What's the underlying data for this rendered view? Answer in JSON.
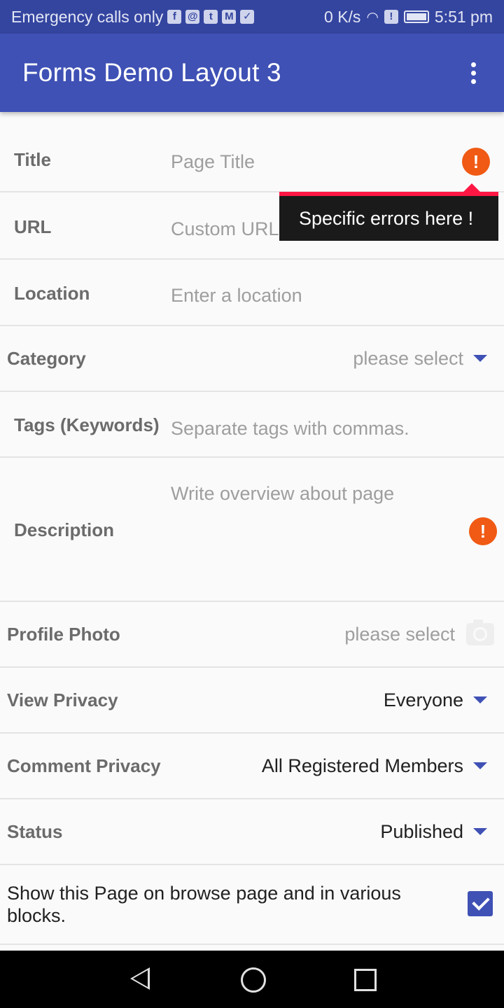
{
  "status_bar": {
    "carrier": "Emergency calls only",
    "speed": "0 K/s",
    "time": "5:51 pm",
    "icons": [
      "facebook-icon",
      "app-icon",
      "twitter-icon",
      "mail-icon",
      "check-icon",
      "wifi-icon",
      "alert-icon",
      "battery-icon"
    ]
  },
  "app_bar": {
    "title": "Forms Demo Layout 3",
    "menu_icon": "more-vert-icon"
  },
  "form": {
    "title": {
      "label": "Title",
      "placeholder": "Page Title",
      "error_icon": "error-icon"
    },
    "url": {
      "label": "URL",
      "placeholder": "Custom URL"
    },
    "location": {
      "label": "Location",
      "placeholder": "Enter a location"
    },
    "category": {
      "label": "Category",
      "value": "please select"
    },
    "tags": {
      "label": "Tags (Keywords)",
      "placeholder": "Separate tags with commas."
    },
    "description": {
      "label": "Description",
      "placeholder": "Write overview about page",
      "error_icon": "error-icon"
    },
    "profile_photo": {
      "label": "Profile Photo",
      "value": "please select",
      "icon": "camera-icon"
    },
    "view_privacy": {
      "label": "View Privacy",
      "value": "Everyone"
    },
    "comment_privacy": {
      "label": "Comment Privacy",
      "value": "All Registered Members"
    },
    "status": {
      "label": "Status",
      "value": "Published"
    },
    "show_on_browse": {
      "label": "Show this Page on browse page and in various blocks.",
      "checked": true
    }
  },
  "error_tooltip": {
    "text": "Specific errors here !"
  },
  "colors": {
    "status_bar": "#3445a0",
    "app_bar": "#3f51b5",
    "error": "#f05a14",
    "tooltip_accent": "#ff1744",
    "accent": "#3f51b5"
  },
  "nav_bar": {
    "icons": [
      "back-icon",
      "home-icon",
      "recents-icon"
    ]
  }
}
